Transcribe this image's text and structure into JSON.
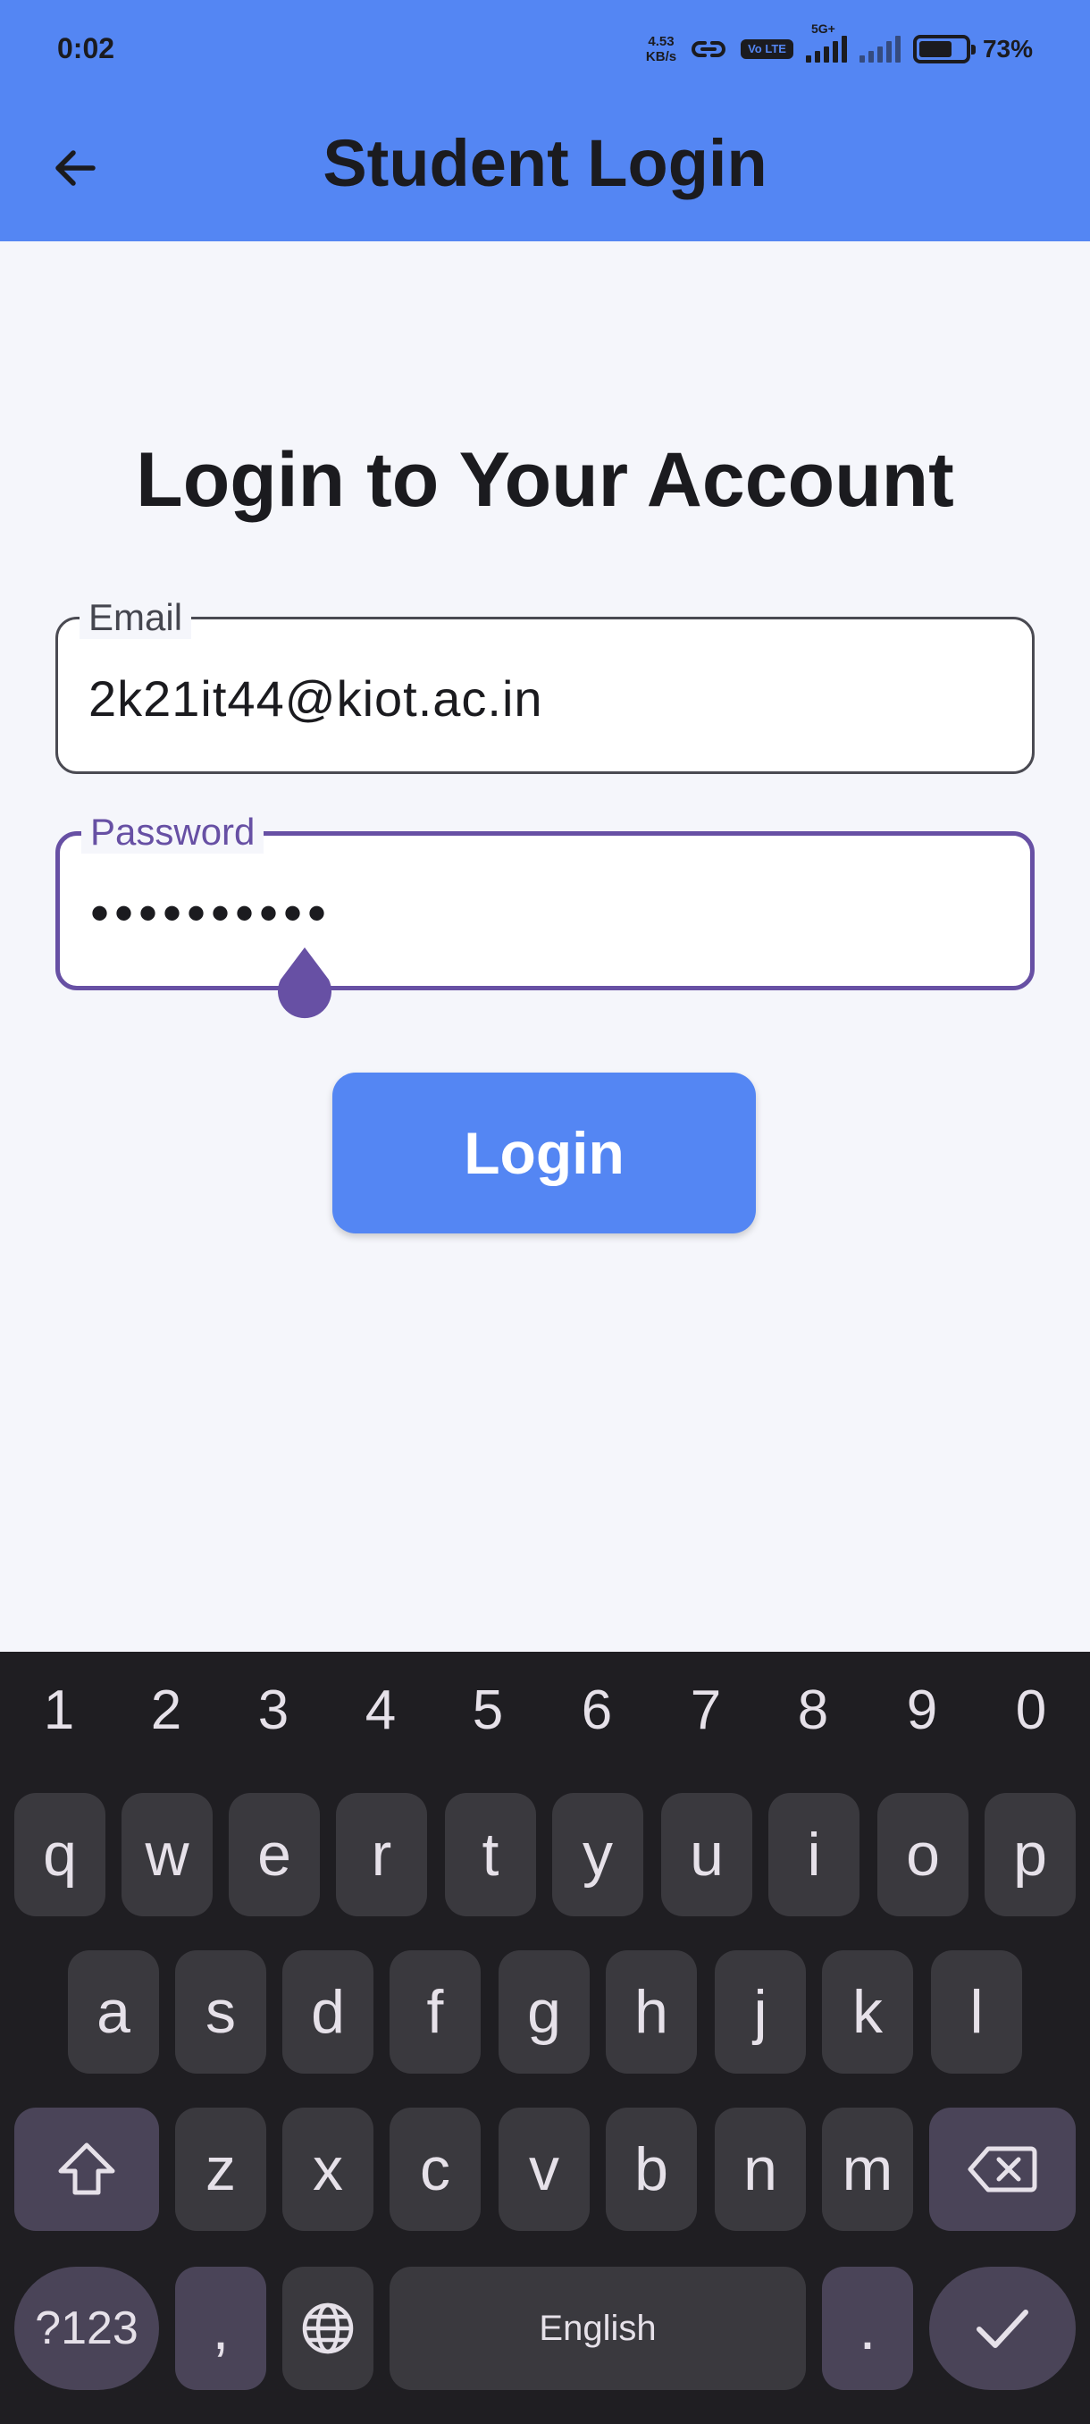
{
  "status_bar": {
    "time": "0:02",
    "net_speed_value": "4.53",
    "net_speed_unit": "KB/s",
    "volte_label": "Vo LTE",
    "network_type": "5G+",
    "battery_percent": "73%",
    "battery_level": 0.73
  },
  "app_bar": {
    "title": "Student Login",
    "back_icon": "arrow-left-icon",
    "background_color": "#5486f3"
  },
  "login_form": {
    "heading": "Login to Your Account",
    "email": {
      "label": "Email",
      "value": "2k21it44@kiot.ac.in"
    },
    "password": {
      "label": "Password",
      "value": "••••••••••",
      "focused": true
    },
    "submit_label": "Login",
    "accent_color": "#6750a4"
  },
  "keyboard": {
    "number_row": [
      "1",
      "2",
      "3",
      "4",
      "5",
      "6",
      "7",
      "8",
      "9",
      "0"
    ],
    "row1": [
      "q",
      "w",
      "e",
      "r",
      "t",
      "y",
      "u",
      "i",
      "o",
      "p"
    ],
    "row2": [
      "a",
      "s",
      "d",
      "f",
      "g",
      "h",
      "j",
      "k",
      "l"
    ],
    "row3": [
      "z",
      "x",
      "c",
      "v",
      "b",
      "n",
      "m"
    ],
    "shift_icon": "shift-arrow-icon",
    "backspace_icon": "backspace-icon",
    "symbols_label": "?123",
    "comma_label": ",",
    "language_icon": "globe-icon",
    "space_label": "English",
    "period_label": ".",
    "enter_icon": "checkmark-icon"
  }
}
